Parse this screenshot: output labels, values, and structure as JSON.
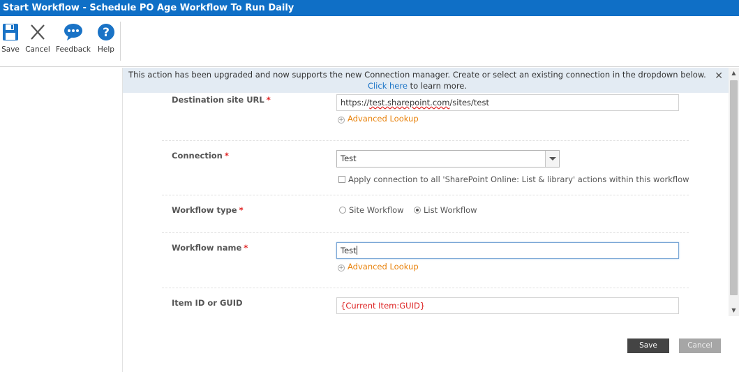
{
  "window": {
    "title": "Start Workflow - Schedule PO Age Workflow To Run Daily"
  },
  "ribbon": {
    "buttons": [
      {
        "label": "Save",
        "icon": "floppy-disk-icon"
      },
      {
        "label": "Cancel",
        "icon": "close-x-icon"
      },
      {
        "label": "Feedback",
        "icon": "speech-bubble-icon"
      },
      {
        "label": "Help",
        "icon": "question-mark-icon"
      }
    ]
  },
  "banner": {
    "text_before_link": "This action has been upgraded and now supports the new Connection manager. Create or select an existing connection in the dropdown below. ",
    "link": "Click here",
    "text_after_link": " to learn more.",
    "close_icon": "close-icon"
  },
  "form": {
    "destination_site_url": {
      "label": "Destination site URL",
      "required_mark": "*",
      "value_prefix": "https://",
      "value_domain": "test.sharepoint.com",
      "value_suffix": "/sites/test",
      "lookup": "Advanced Lookup"
    },
    "connection": {
      "label": "Connection",
      "required_mark": "*",
      "selected": "Test",
      "apply_all_label": "Apply connection to all 'SharePoint Online: List & library' actions within this workflow",
      "apply_all_checked": false
    },
    "workflow_type": {
      "label": "Workflow type",
      "required_mark": "*",
      "options": [
        "Site Workflow",
        "List Workflow"
      ],
      "selected": "List Workflow"
    },
    "workflow_name": {
      "label": "Workflow name",
      "required_mark": "*",
      "value": "Test",
      "lookup": "Advanced Lookup"
    },
    "item_id": {
      "label": "Item ID or GUID",
      "value": "{Current Item:GUID}"
    }
  },
  "footer": {
    "save_label": "Save",
    "cancel_label": "Cancel"
  },
  "colors": {
    "titlebar": "#0f6fc6",
    "accent_icon": "#1a73c6",
    "lookup_orange": "#e8820c",
    "required_red": "#e02020"
  }
}
